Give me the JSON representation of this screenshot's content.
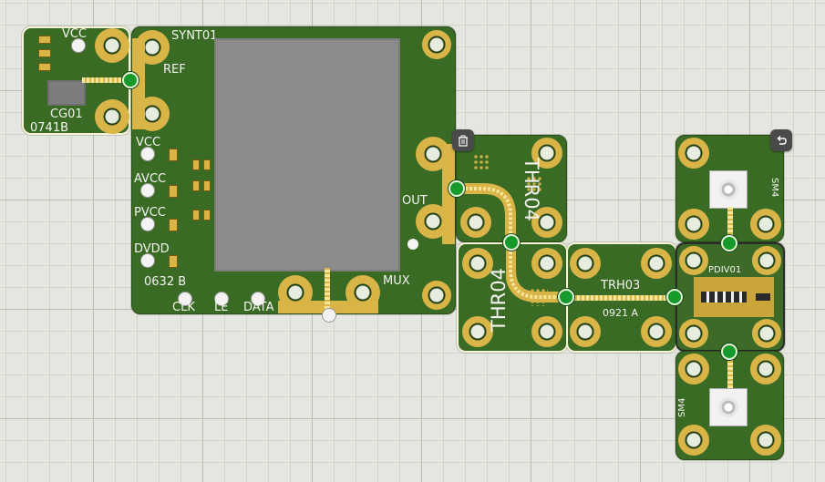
{
  "boards": {
    "cg01": {
      "name": "CG01",
      "vcc": "VCC",
      "code": "0741B"
    },
    "synt01": {
      "name": "SYNT01",
      "ref": "REF",
      "vcc": "VCC",
      "avcc": "AVCC",
      "pvcc": "PVCC",
      "dvdd": "DVDD",
      "out": "OUT",
      "mux": "MUX",
      "code": "0632 B",
      "clk": "CLK",
      "le": "LE",
      "data": "DATA"
    },
    "thr04_top": {
      "name": "THR04"
    },
    "thr04_bottom": {
      "name": "THR04"
    },
    "trh03": {
      "name": "TRH03",
      "code": "0921 A"
    },
    "sm4_top": {
      "name": "SM4"
    },
    "pdiv01": {
      "name": "PDIV01"
    },
    "sm4_bottom": {
      "name": "SM4"
    }
  },
  "icons": {
    "delete": "trash-icon",
    "undo": "undo-icon"
  },
  "colors": {
    "board": "#3a6b25",
    "gold": "#d9b447",
    "node": "#159a2b"
  }
}
